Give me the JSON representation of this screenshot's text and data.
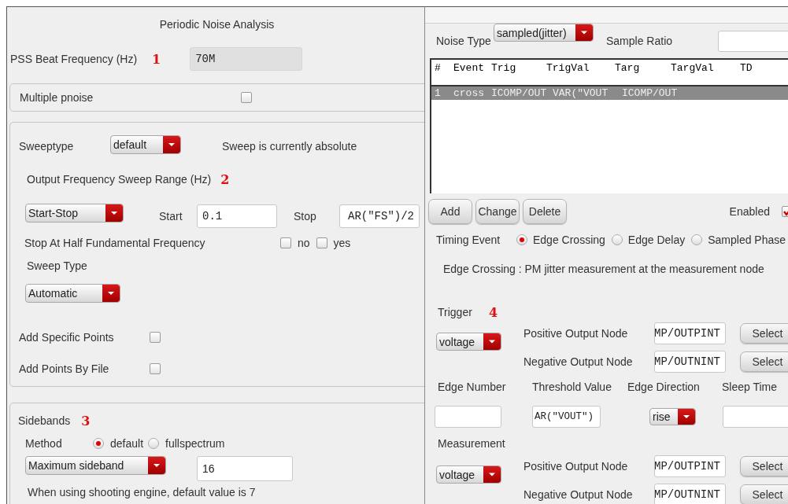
{
  "left": {
    "title": "Periodic Noise Analysis",
    "beat": {
      "label": "PSS Beat Frequency (Hz)",
      "marker": "1",
      "value": "70M",
      "disabled": true
    },
    "multiple_pnoise": {
      "label": "Multiple pnoise",
      "checked": false
    },
    "sweep": {
      "sweeptype_label": "Sweeptype",
      "sweeptype": "default",
      "status": "Sweep is currently absolute",
      "range_label": "Output Frequency Sweep Range (Hz)",
      "range_marker": "2",
      "range_mode": "Start-Stop",
      "start_label": "Start",
      "start": "0.1",
      "stop_label": "Stop",
      "stop": "AR(\"FS\")/2",
      "half_label": "Stop At Half Fundamental Frequency",
      "half_options": [
        {
          "label": "no",
          "checked": false
        },
        {
          "label": "yes",
          "checked": false
        }
      ],
      "sweep_type_label": "Sweep Type",
      "sweep_type": "Automatic",
      "options": [
        {
          "label": "Add Specific Points",
          "checked": false
        },
        {
          "label": "Add Points By File",
          "checked": false
        }
      ]
    },
    "sidebands": {
      "label": "Sidebands",
      "marker": "3",
      "method_label": "Method",
      "methods": [
        {
          "label": "default",
          "selected": true
        },
        {
          "label": "fullspectrum",
          "selected": false
        }
      ],
      "mode": "Maximum sideband",
      "value": "16",
      "note": "When using shooting engine, default value is 7"
    }
  },
  "right": {
    "noise_type_label": "Noise Type",
    "noise_type": "sampled(jitter)",
    "sample_ratio_label": "Sample Ratio",
    "table": {
      "columns": [
        "#",
        "Event",
        "Trig",
        "TrigVal",
        "Targ",
        "TargVal",
        "TD"
      ],
      "rows": [
        {
          "cells": [
            "1",
            "cross",
            "ICOMP/OUT",
            "VAR(\"VOUT",
            "ICOMP/OUT"
          ],
          "selected": true
        }
      ]
    },
    "buttons": [
      "Add",
      "Change",
      "Delete"
    ],
    "enabled": {
      "label": "Enabled",
      "checked": true
    },
    "timing_label": "Timing Event",
    "timing_events": [
      {
        "label": "Edge Crossing",
        "selected": true
      },
      {
        "label": "Edge Delay",
        "selected": false
      },
      {
        "label": "Sampled Phase",
        "selected": false
      }
    ],
    "description": "Edge Crossing : PM jitter measurement at the measurement node",
    "trigger": {
      "label": "Trigger",
      "marker": "4",
      "type": "voltage",
      "nodes": [
        {
          "label": "Positive Output Node",
          "value": "MP/OUTPINT",
          "button": "Select"
        },
        {
          "label": "Negative Output Node",
          "value": "MP/OUTNINT",
          "button": "Select"
        }
      ]
    },
    "edge": {
      "labels": [
        "Edge Number",
        "Threshold Value",
        "Edge Direction",
        "Sleep Time"
      ],
      "threshold": "AR(\"VOUT\")",
      "direction": "rise"
    },
    "measurement": {
      "label": "Measurement",
      "type": "voltage",
      "nodes": [
        {
          "label": "Positive Output Node",
          "value": "MP/OUTPINT",
          "button": "Select"
        },
        {
          "label": "Negative Output Node",
          "value": "MP/OUTNINT",
          "button": "Select"
        }
      ]
    }
  }
}
